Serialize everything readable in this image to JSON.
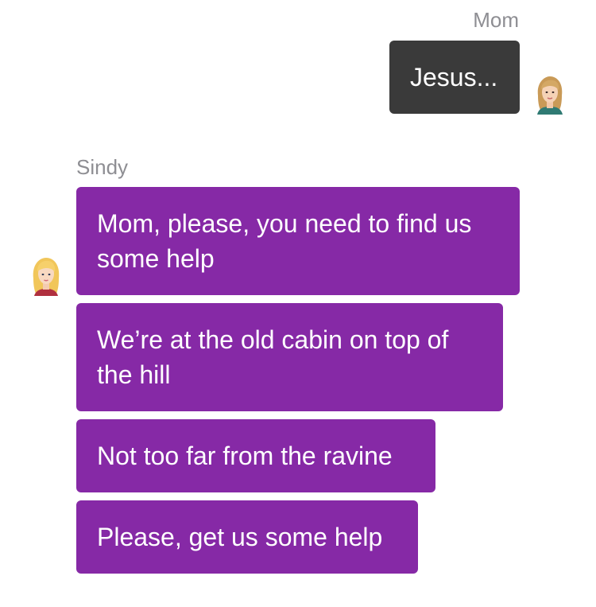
{
  "conversation": {
    "mom": {
      "name": "Mom",
      "avatar_icon": "mom-avatar-icon",
      "messages": [
        "Jesus..."
      ]
    },
    "sindy": {
      "name": "Sindy",
      "avatar_icon": "sindy-avatar-icon",
      "messages": [
        "Mom, please, you need to find us some help",
        "We’re at the old cabin on top of the hill",
        "Not too far from the ravine",
        "Please, get us some help"
      ]
    }
  },
  "colors": {
    "outgoing_bubble": "#3a3a3a",
    "incoming_bubble": "#8629a6",
    "name_label": "#8e8e93",
    "bubble_text": "#ffffff"
  }
}
